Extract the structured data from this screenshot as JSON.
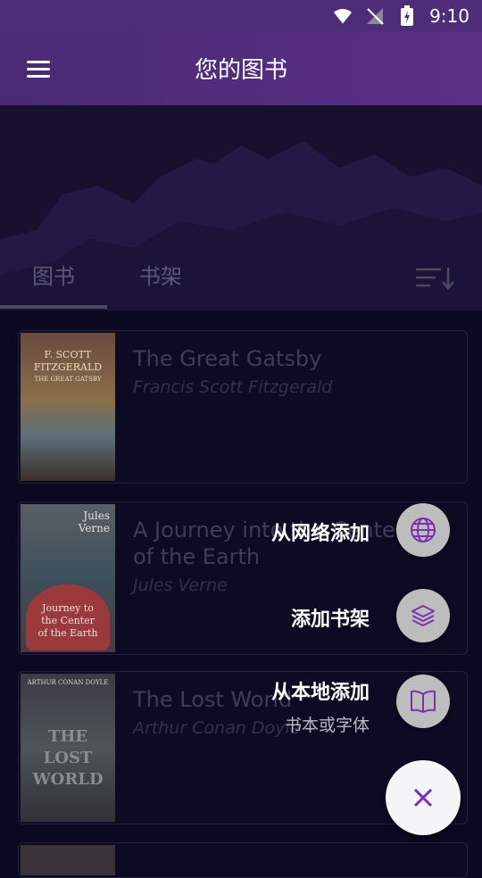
{
  "status_bar": {
    "time": "9:10"
  },
  "app_bar": {
    "title": "您的图书"
  },
  "tabs": [
    {
      "label": "图书"
    },
    {
      "label": "书架"
    }
  ],
  "books": [
    {
      "title": "The Great Gatsby",
      "author": "Francis Scott Fitzgerald",
      "cover_text": [
        "F. SCOTT",
        "FITZGERALD",
        "THE GREAT GATSBY"
      ]
    },
    {
      "title": "A Journey into the Center",
      "title_line2": "of the Earth",
      "author": "Jules Verne",
      "cover_text": [
        "Jules",
        "Verne",
        "Journey to",
        "the Center",
        "of the Earth"
      ]
    },
    {
      "title": "The Lost World",
      "author": "Arthur Conan Doyle",
      "cover_text": [
        "ARTHUR CONAN DOYLE",
        "THE",
        "LOST",
        "WORLD"
      ]
    }
  ],
  "fab_menu": {
    "add_from_web": "从网络添加",
    "add_shelf": "添加书架",
    "add_local": "从本地添加",
    "add_local_sub": "书本或字体"
  },
  "colors": {
    "accent": "#7b2fb5",
    "appbar": "#4a2a74",
    "background": "#0b0822"
  },
  "icons": [
    "wifi-icon",
    "signal-icon",
    "battery-icon",
    "menu-icon",
    "sort-icon",
    "globe-icon",
    "layers-icon",
    "book-open-icon",
    "close-icon"
  ]
}
